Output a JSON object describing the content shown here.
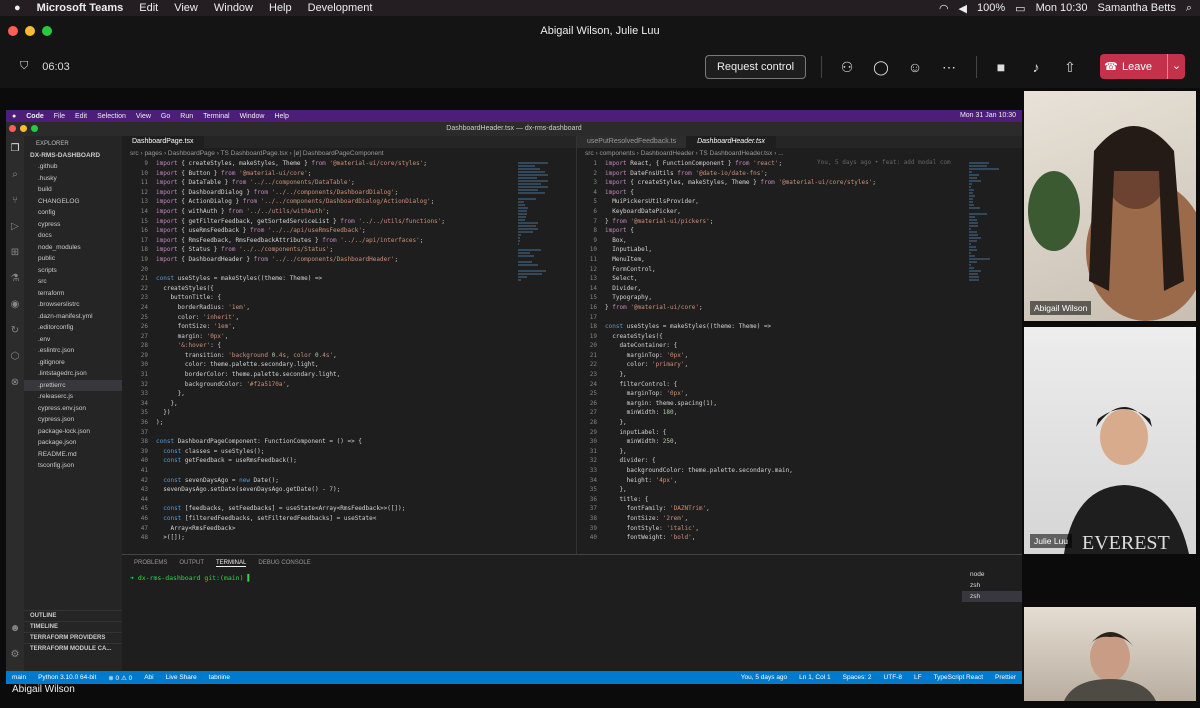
{
  "mac_menu": {
    "app": "Microsoft Teams",
    "items": [
      "Edit",
      "View",
      "Window",
      "Help",
      "Development"
    ],
    "battery": "100%",
    "clock": "Mon 10:30",
    "user": "Samantha Betts"
  },
  "window_title": "Abigail Wilson, Julie Luu",
  "toolbar": {
    "timer": "06:03",
    "request_control": "Request control",
    "leave": "Leave"
  },
  "vscode": {
    "mac_menu": [
      "Code",
      "File",
      "Edit",
      "Selection",
      "View",
      "Go",
      "Run",
      "Terminal",
      "Window",
      "Help"
    ],
    "clock": "Mon 31 Jan  10:30",
    "title": "DashboardHeader.tsx — dx-rms-dashboard",
    "explorer": {
      "header": "EXPLORER",
      "root": "DX-RMS-DASHBOARD",
      "items": [
        ".github",
        ".husky",
        "build",
        "CHANGELOG",
        "config",
        "cypress",
        "docs",
        "node_modules",
        "public",
        "scripts",
        "src",
        "terraform",
        ".browserslistrc",
        ".dazn-manifest.yml",
        ".editorconfig",
        ".env",
        ".eslintrc.json",
        ".gitignore",
        ".lintstagedrc.json",
        ".prettierrc",
        ".releaserc.js",
        "cypress.env.json",
        "cypress.json",
        "package-lock.json",
        "package.json",
        "README.md",
        "tsconfig.json"
      ],
      "sections": [
        "OUTLINE",
        "TIMELINE",
        "TERRAFORM PROVIDERS",
        "TERRAFORM MODULE CA..."
      ]
    },
    "left_editor": {
      "tab": "DashboardPage.tsx",
      "breadcrumb": "src › pages › DashboardPage › TS DashboardPage.tsx › [ø] DashboardPageComponent",
      "line_numbers": [
        "9",
        "10",
        "11",
        "12",
        "13",
        "14",
        "15",
        "16",
        "17",
        "18",
        "19",
        "20",
        "21",
        "22",
        "23",
        "24",
        "25",
        "26",
        "27",
        "28",
        "29",
        "30",
        "31",
        "32",
        "33",
        "34",
        "35",
        "36",
        "37",
        "38",
        "39",
        "40",
        "41",
        "42",
        "43",
        "44",
        "45",
        "46",
        "47",
        "48"
      ],
      "lines": [
        "import { createStyles, makeStyles, Theme } from '@material-ui/core/styles';",
        "import { Button } from '@material-ui/core';",
        "import { DataTable } from '../../components/DataTable';",
        "import { DashboardDialog } from '../../components/DashboardDialog';",
        "import { ActionDialog } from '../../components/DashboardDialog/ActionDialog';",
        "import { withAuth } from '../../utils/withAuth';",
        "import { getFilterFeedback, getSortedServiceList } from '../../utils/functions';",
        "import { useRmsFeedback } from '../../api/useRmsFeedback';",
        "import { RmsFeedback, RmsFeedbackAttributes } from '../../api/interfaces';",
        "import { Status } from '../../components/Status';",
        "import { DashboardHeader } from '../../components/DashboardHeader';",
        "",
        "const useStyles = makeStyles((theme: Theme) =>",
        "  createStyles({",
        "    buttonTitle: {",
        "      borderRadius: '1em',",
        "      color: 'inherit',",
        "      fontSize: '1em',",
        "      margin: '0px',",
        "      '&:hover': {",
        "        transition: 'background 0.4s, color 0.4s',",
        "        color: theme.palette.secondary.light,",
        "        borderColor: theme.palette.secondary.light,",
        "        backgroundColor: '#f2a5170a',",
        "      },",
        "    },",
        "  })",
        ");",
        "",
        "const DashboardPageComponent: FunctionComponent = () => {",
        "  const classes = useStyles();",
        "  const getFeedback = useRmsFeedback();",
        "",
        "  const sevenDaysAgo = new Date();",
        "  sevenDaysAgo.setDate(sevenDaysAgo.getDate() - 7);",
        "",
        "  const [feedbacks, setFeedbacks] = useState<Array<RmsFeedback>>([]);",
        "  const [filteredFeedbacks, setFilteredFeedbacks] = useState<",
        "    Array<RmsFeedback>",
        "  >([]);"
      ]
    },
    "right_editor": {
      "tabs": [
        "usePutResolvedFeedback.ts",
        "DashboardHeader.tsx"
      ],
      "breadcrumb": "src › components › DashboardHeader › TS DashboardHeader.tsx › ...",
      "blame": "You, 5 days ago • feat: add modal com",
      "line_numbers": [
        "1",
        "2",
        "3",
        "4",
        "5",
        "6",
        "7",
        "8",
        "9",
        "10",
        "11",
        "12",
        "13",
        "14",
        "15",
        "16",
        "17",
        "18",
        "19",
        "20",
        "21",
        "22",
        "23",
        "24",
        "25",
        "26",
        "27",
        "28",
        "29",
        "30",
        "31",
        "32",
        "33",
        "34",
        "35",
        "36",
        "37",
        "38",
        "39",
        "40"
      ],
      "lines": [
        "import React, { FunctionComponent } from 'react';",
        "import DateFnsUtils from '@date-io/date-fns';",
        "import { createStyles, makeStyles, Theme } from '@material-ui/core/styles';",
        "import {",
        "  MuiPickersUtilsProvider,",
        "  KeyboardDatePicker,",
        "} from '@material-ui/pickers';",
        "import {",
        "  Box,",
        "  InputLabel,",
        "  MenuItem,",
        "  FormControl,",
        "  Select,",
        "  Divider,",
        "  Typography,",
        "} from '@material-ui/core';",
        "",
        "const useStyles = makeStyles((theme: Theme) =>",
        "  createStyles({",
        "    dateContainer: {",
        "      marginTop: '0px',",
        "      color: 'primary',",
        "    },",
        "    filterControl: {",
        "      marginTop: '0px',",
        "      margin: theme.spacing(1),",
        "      minWidth: 180,",
        "    },",
        "    inputLabel: {",
        "      minWidth: 250,",
        "    },",
        "    divider: {",
        "      backgroundColor: theme.palette.secondary.main,",
        "      height: '4px',",
        "    },",
        "    title: {",
        "      fontFamily: 'DAZNTrim',",
        "      fontSize: '2rem',",
        "      fontStyle: 'italic',",
        "      fontWeight: 'bold',"
      ]
    },
    "panel": {
      "tabs": [
        "PROBLEMS",
        "OUTPUT",
        "TERMINAL",
        "DEBUG CONSOLE"
      ],
      "prompt": "➜  dx-rms-dashboard git:(main) ▌",
      "terminals": [
        "node",
        "zsh",
        "zsh"
      ]
    },
    "status": {
      "branch": "main",
      "python": "Python 3.10.0 64-bit",
      "problems": "⊗ 0 ⚠ 0",
      "abi": "Abi",
      "liveshare": "Live Share",
      "tabnine": "tabnine",
      "blame": "You, 5 days ago",
      "position": "Ln 1, Col 1",
      "spaces": "Spaces: 2",
      "encoding": "UTF-8",
      "eol": "LF",
      "language": "TypeScript React",
      "prettier": "Prettier"
    }
  },
  "presenter": "Abigail Wilson",
  "participants": [
    {
      "name": "Abigail Wilson"
    },
    {
      "name": "Julie Luu",
      "shirt_text": "EVEREST"
    },
    {
      "name": ""
    }
  ],
  "colors": {
    "leave": "#c4314b",
    "vscode_menu": "#4d1d7a",
    "status_bar": "#007acc"
  }
}
